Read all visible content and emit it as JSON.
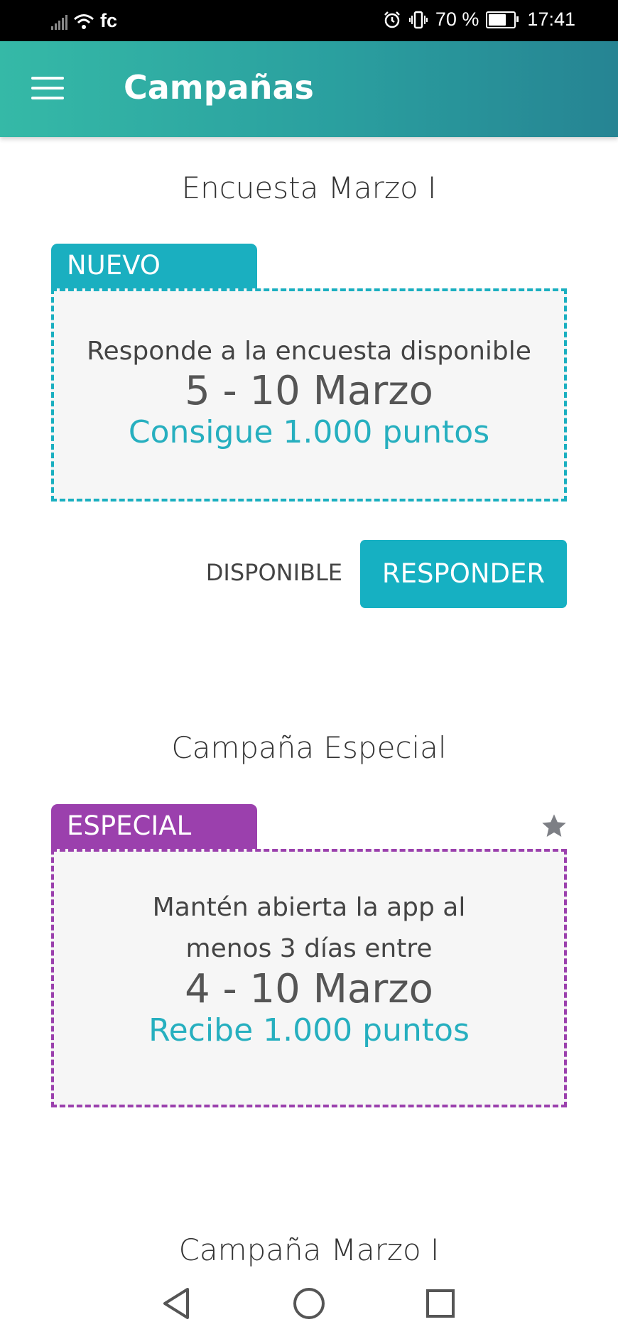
{
  "status_bar": {
    "carrier": "fc",
    "battery": "70 %",
    "battery_level": 0.7,
    "time": "17:41"
  },
  "app_bar": {
    "menu_icon": "hamburger-menu-icon",
    "title": "Campañas"
  },
  "campaigns": [
    {
      "title": "Encuesta Marzo I",
      "tag": "NUEVO",
      "tag_color": "#1aafc0",
      "border_color": "#1aafc0",
      "description": "Responde a la encuesta disponible",
      "dates": "5 - 10 Marzo",
      "reward": "Consigue 1.000 puntos",
      "reward_color": "#26afbf",
      "status": "DISPONIBLE",
      "action": "RESPONDER"
    },
    {
      "title": "Campaña Especial",
      "tag": "ESPECIAL",
      "tag_color": "#9b40ad",
      "border_color": "#9b40ad",
      "description": "Mantén abierta la app al menos 3 días entre",
      "dates": "4 - 10 Marzo",
      "reward": "Recibe 1.000 puntos",
      "reward_color": "#26afbf",
      "star_icon": "star-icon"
    },
    {
      "title": "Campaña Marzo I"
    }
  ],
  "nav_bar": {
    "back_icon": "back-triangle-icon",
    "home_icon": "home-circle-icon",
    "recents_icon": "recents-square-icon"
  }
}
